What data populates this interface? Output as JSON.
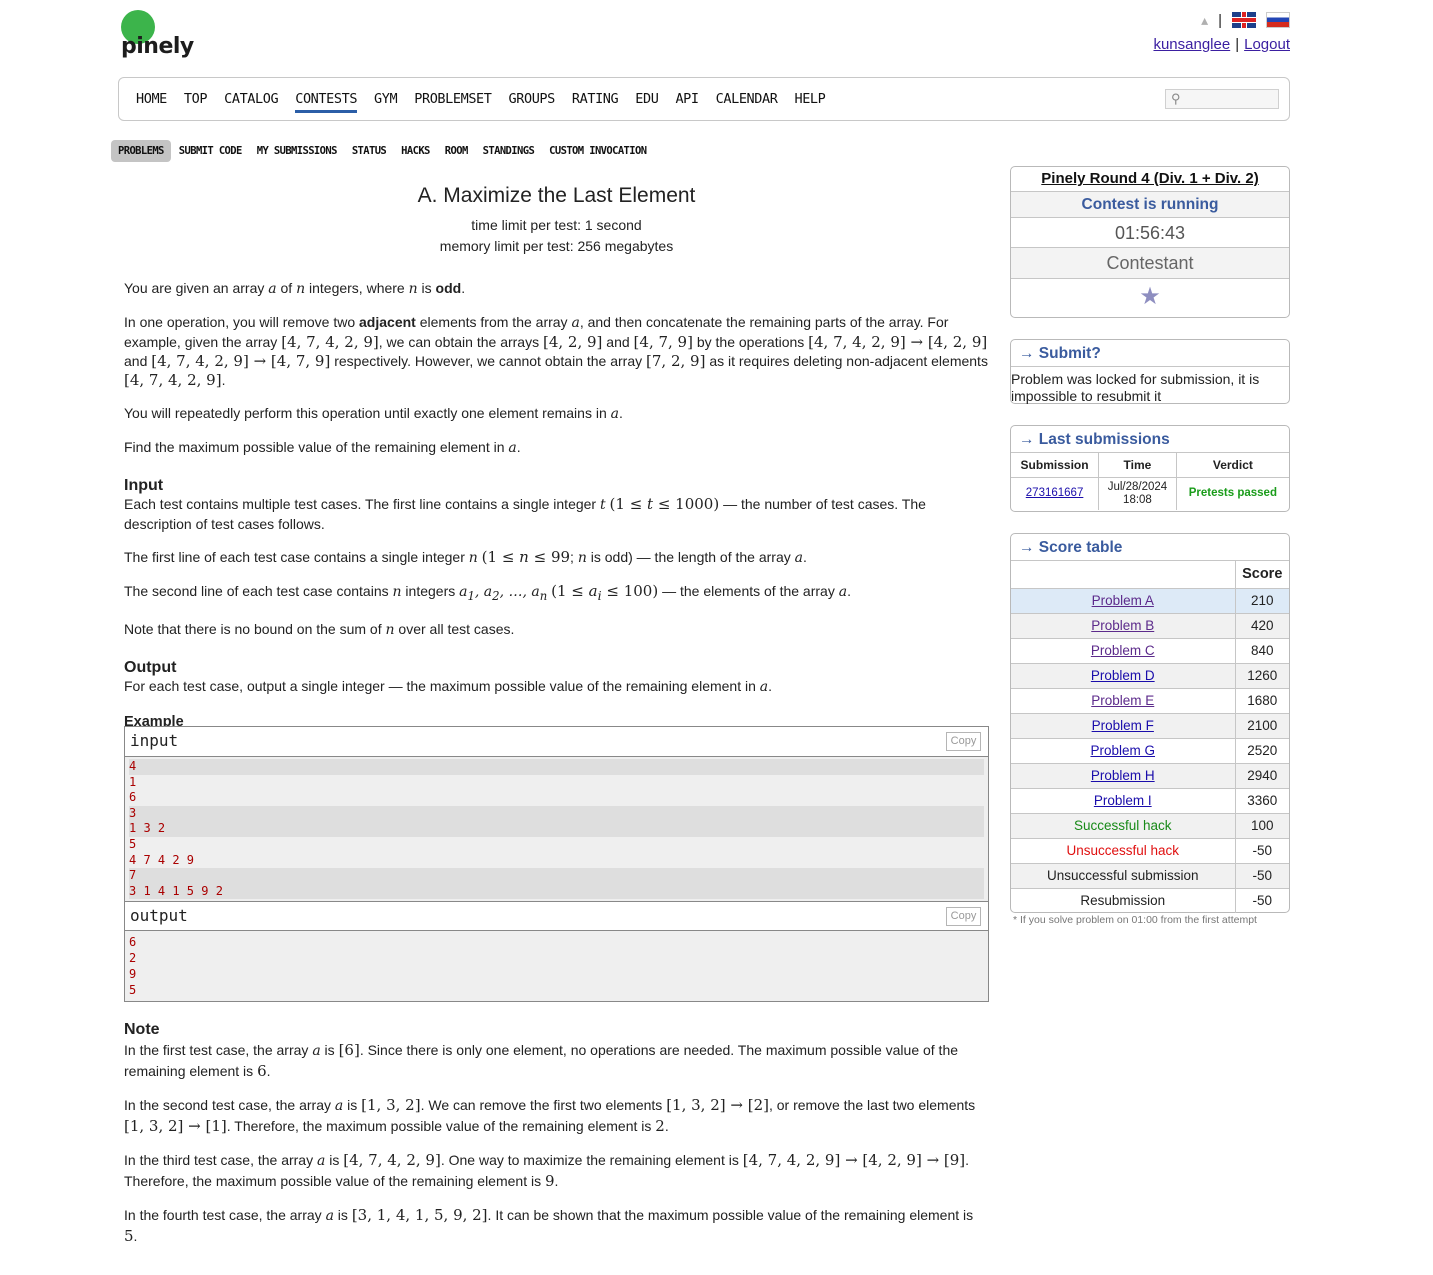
{
  "header": {
    "logo_text": "pinely",
    "username": "kunsanglee",
    "logout": "Logout",
    "separator": "|"
  },
  "main_nav": [
    "HOME",
    "TOP",
    "CATALOG",
    "CONTESTS",
    "GYM",
    "PROBLEMSET",
    "GROUPS",
    "RATING",
    "EDU",
    "API",
    "CALENDAR",
    "HELP"
  ],
  "main_nav_active": "CONTESTS",
  "search": {
    "placeholder": ""
  },
  "second_nav": [
    "PROBLEMS",
    "SUBMIT CODE",
    "MY SUBMISSIONS",
    "STATUS",
    "HACKS",
    "ROOM",
    "STANDINGS",
    "CUSTOM INVOCATION"
  ],
  "second_nav_active": "PROBLEMS",
  "problem": {
    "title": "A. Maximize the Last Element",
    "time_limit": "time limit per test: 1 second",
    "memory_limit": "memory limit per test: 256 megabytes",
    "input_title": "Input",
    "output_title": "Output",
    "example_title": "Example",
    "note_title": "Note"
  },
  "sample": {
    "input_label": "input",
    "output_label": "output",
    "copy": "Copy",
    "input_lines": [
      "4",
      "1",
      "6",
      "3",
      "1 3 2",
      "5",
      "4 7 4 2 9",
      "7",
      "3 1 4 1 5 9 2"
    ],
    "output_lines": [
      "6",
      "2",
      "9",
      "5"
    ]
  },
  "contest": {
    "name": "Pinely Round 4 (Div. 1 + Div. 2)",
    "status": "Contest is running",
    "timer": "01:56:43",
    "role": "Contestant"
  },
  "submit_box": {
    "title": "→ Submit?",
    "text": "Problem was locked for submission, it is impossible to resubmit it"
  },
  "last_submissions": {
    "title": "→ Last submissions",
    "headers": [
      "Submission",
      "Time",
      "Verdict"
    ],
    "rows": [
      {
        "id": "273161667",
        "time_date": "Jul/28/2024",
        "time_clock": "18:08",
        "verdict": "Pretests passed"
      }
    ]
  },
  "score_table": {
    "title": "→ Score table",
    "score_header": "Score",
    "rows": [
      {
        "name": "Problem A",
        "score": "210"
      },
      {
        "name": "Problem B",
        "score": "420"
      },
      {
        "name": "Problem C",
        "score": "840"
      },
      {
        "name": "Problem D",
        "score": "1260"
      },
      {
        "name": "Problem E",
        "score": "1680"
      },
      {
        "name": "Problem F",
        "score": "2100"
      },
      {
        "name": "Problem G",
        "score": "2520"
      },
      {
        "name": "Problem H",
        "score": "2940"
      },
      {
        "name": "Problem I",
        "score": "3360"
      },
      {
        "name": "Successful hack",
        "score": "100"
      },
      {
        "name": "Unsuccessful hack",
        "score": "-50"
      },
      {
        "name": "Unsuccessful submission",
        "score": "-50"
      },
      {
        "name": "Resubmission",
        "score": "-50"
      }
    ],
    "footnote": "* If you solve problem on 01:00 from the first attempt"
  },
  "colors": {
    "accent": "#3a5b9e",
    "nav_underline": "#2b5ea7",
    "logo_green": "#3cb44b",
    "sample_text": "#aa0000"
  }
}
